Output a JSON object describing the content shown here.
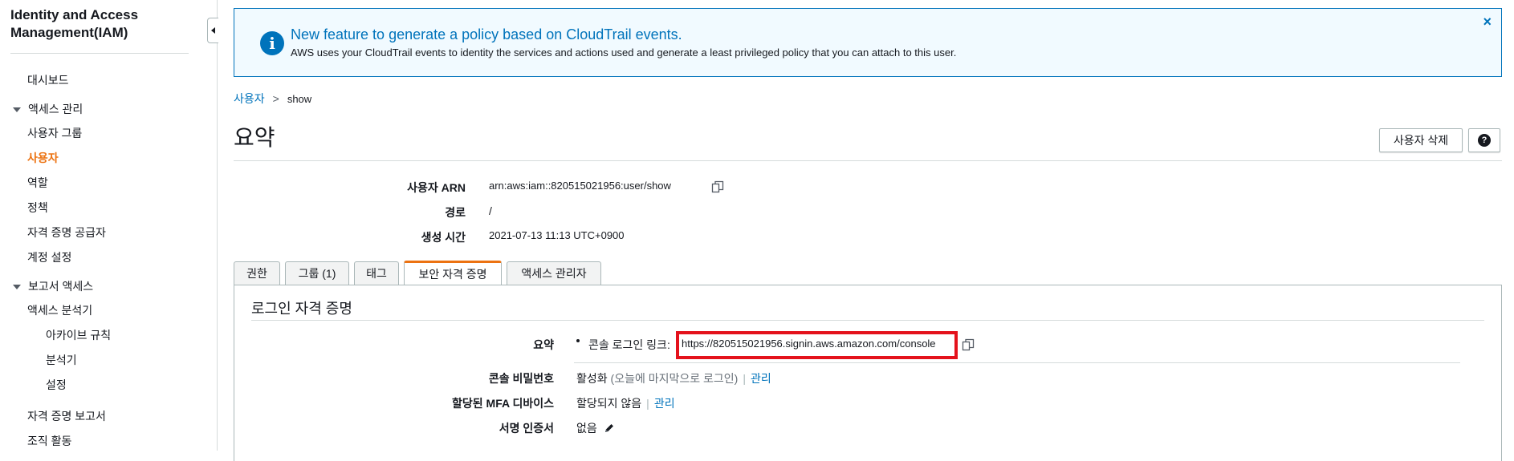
{
  "sidebar": {
    "title": "Identity and Access Management(IAM)",
    "dashboard": "대시보드",
    "access_mgmt": "액세스 관리",
    "items": [
      {
        "label": "사용자 그룹"
      },
      {
        "label": "사용자",
        "active": true
      },
      {
        "label": "역할"
      },
      {
        "label": "정책"
      },
      {
        "label": "자격 증명 공급자"
      },
      {
        "label": "계정 설정"
      }
    ],
    "reports_access": "보고서 액세스",
    "access_analyzer": "액세스 분석기",
    "analyzer_items": [
      {
        "label": "아카이브 규칙"
      },
      {
        "label": "분석기"
      },
      {
        "label": "설정"
      }
    ],
    "credential_report": "자격 증명 보고서",
    "org_activity": "조직 활동"
  },
  "banner": {
    "title": "New feature to generate a policy based on CloudTrail events.",
    "text": "AWS uses your CloudTrail events to identity the services and actions used and generate a least privileged policy that you can attach to this user.",
    "icon": "info-icon",
    "close": "×"
  },
  "breadcrumb": {
    "parent": "사용자",
    "separator": ">",
    "current": "show"
  },
  "page": {
    "title": "요약",
    "delete_button": "사용자 삭제",
    "help_button": "?"
  },
  "summary": {
    "arn_label": "사용자 ARN",
    "arn_value": "arn:aws:iam::820515021956:user/show",
    "path_label": "경로",
    "path_value": "/",
    "created_label": "생성 시간",
    "created_value": "2021-07-13 11:13 UTC+0900"
  },
  "tabs": [
    {
      "label": "권한"
    },
    {
      "label": "그룹 (1)"
    },
    {
      "label": "태그"
    },
    {
      "label": "보안 자격 증명",
      "active": true
    },
    {
      "label": "액세스 관리자"
    }
  ],
  "credentials": {
    "section_title": "로그인 자격 증명",
    "summary_label": "요약",
    "console_link_label": "콘솔 로그인 링크:",
    "console_link_url": "https://820515021956.signin.aws.amazon.com/console",
    "console_password_label": "콘솔 비밀번호",
    "console_password_status": "활성화",
    "console_password_note": "(오늘에 마지막으로 로그인)",
    "manage": "관리",
    "mfa_label": "할당된 MFA 디바이스",
    "mfa_value": "할당되지 않음",
    "signing_cert_label": "서명 인증서",
    "signing_cert_value": "없음"
  },
  "colors": {
    "accent_orange": "#ec7211",
    "link_blue": "#0073bb",
    "highlight_red": "#e4121c",
    "banner_bg": "#f1faff"
  }
}
